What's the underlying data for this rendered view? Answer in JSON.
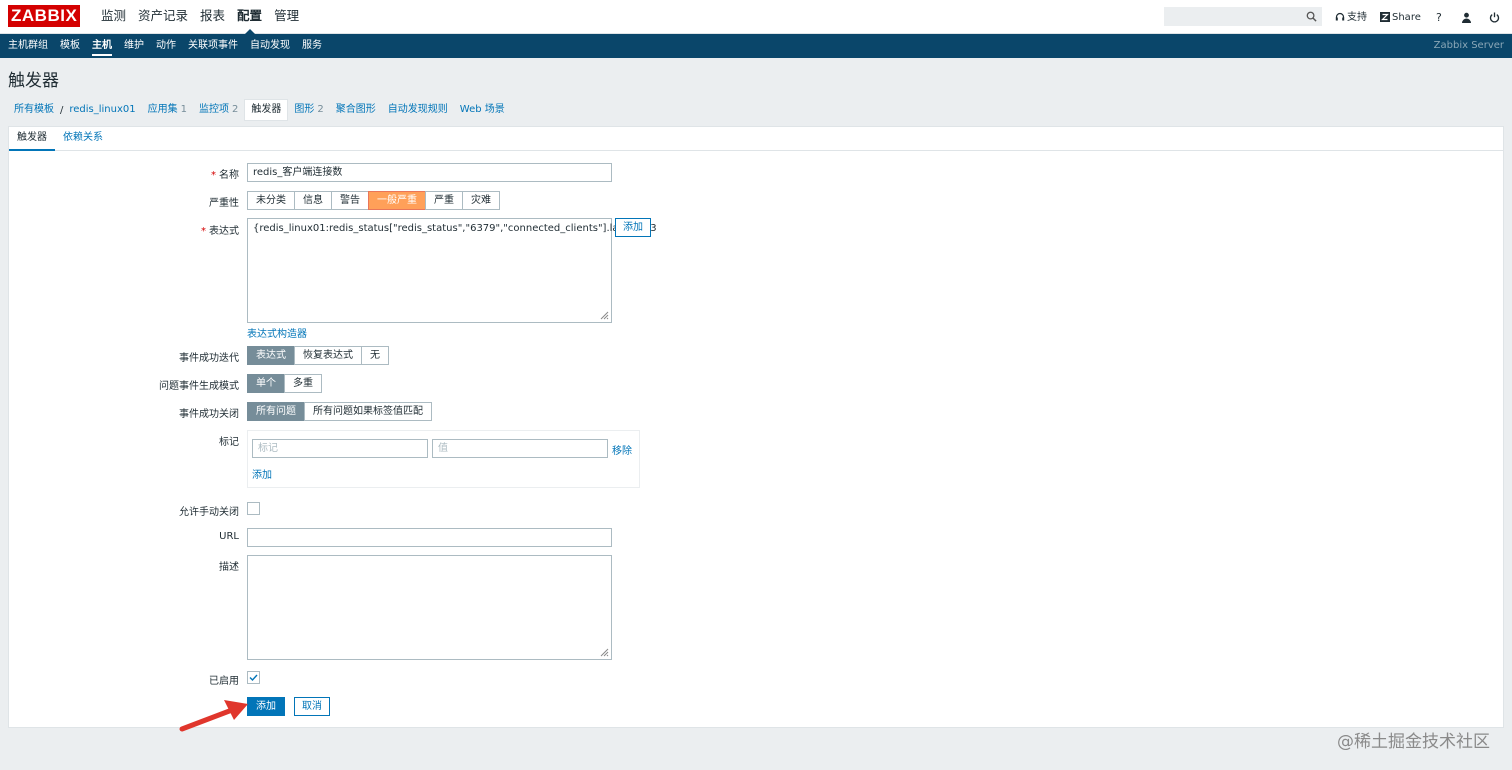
{
  "header": {
    "logo": "ZABBIX",
    "nav": [
      "监测",
      "资产记录",
      "报表",
      "配置",
      "管理"
    ],
    "active_nav": "配置",
    "search_placeholder": "",
    "support": "支持",
    "share": "Share",
    "help": "?"
  },
  "subnav": {
    "items": [
      "主机群组",
      "模板",
      "主机",
      "维护",
      "动作",
      "关联项事件",
      "自动发现",
      "服务"
    ],
    "active": "主机",
    "server": "Zabbix Server"
  },
  "page_title": "触发器",
  "breadcrumbs": {
    "all_templates": "所有模板",
    "sep": "/",
    "host": "redis_linux01",
    "applications": "应用集",
    "applications_count": "1",
    "items": "监控项",
    "items_count": "2",
    "triggers": "触发器",
    "graphs": "图形",
    "graphs_count": "2",
    "screens": "聚合图形",
    "discovery": "自动发现规则",
    "web": "Web 场景"
  },
  "tabs": {
    "trigger": "触发器",
    "dependencies": "依赖关系"
  },
  "form": {
    "name_label": "名称",
    "name_value": "redis_客户端连接数",
    "severity_label": "严重性",
    "severity_options": [
      "未分类",
      "信息",
      "警告",
      "一般严重",
      "严重",
      "灾难"
    ],
    "severity_selected": "一般严重",
    "expression_label": "表达式",
    "expression_value": "{redis_linux01:redis_status[\"redis_status\",\"6379\",\"connected_clients\"].last()}>3",
    "expression_add": "添加",
    "expression_builder": "表达式构造器",
    "ok_event_label": "事件成功迭代",
    "ok_event_options": [
      "表达式",
      "恢复表达式",
      "无"
    ],
    "ok_event_selected": "表达式",
    "problem_mode_label": "问题事件生成模式",
    "problem_mode_options": [
      "单个",
      "多重"
    ],
    "problem_mode_selected": "单个",
    "ok_close_label": "事件成功关闭",
    "ok_close_options": [
      "所有问题",
      "所有问题如果标签值匹配"
    ],
    "ok_close_selected": "所有问题",
    "tags_label": "标记",
    "tag_placeholder": "标记",
    "value_placeholder": "值",
    "remove": "移除",
    "add": "添加",
    "manual_close_label": "允许手动关闭",
    "manual_close_checked": false,
    "url_label": "URL",
    "url_value": "",
    "description_label": "描述",
    "description_value": "",
    "enabled_label": "已启用",
    "enabled_checked": true,
    "submit": "添加",
    "cancel": "取消"
  },
  "watermark": "@稀土掘金技术社区",
  "colors": {
    "header_blue": "#0a466a",
    "link_blue": "#0275b8",
    "severity_average": "#ffa059",
    "logo_red": "#d40000",
    "arrow_red": "#e0362c"
  }
}
